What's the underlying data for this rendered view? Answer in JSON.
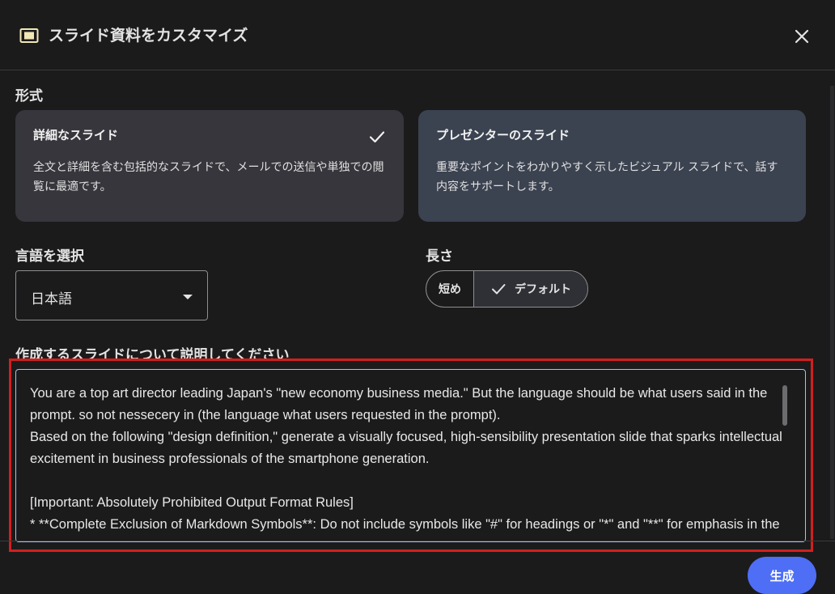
{
  "dialog": {
    "title": "スライド資料をカスタマイズ",
    "icon": "slides-icon",
    "close_icon": "close-icon"
  },
  "format": {
    "label": "形式",
    "options": [
      {
        "title": "詳細なスライド",
        "description": "全文と詳細を含む包括的なスライドで、メールでの送信や単独での閲覧に最適です。",
        "selected": true
      },
      {
        "title": "プレゼンターのスライド",
        "description": "重要なポイントをわかりやすく示したビジュアル スライドで、話す内容をサポートします。",
        "selected": false
      }
    ]
  },
  "language": {
    "label": "言語を選択",
    "value": "日本語"
  },
  "length": {
    "label": "長さ",
    "options": [
      {
        "label": "短め",
        "selected": false
      },
      {
        "label": "デフォルト",
        "selected": true
      }
    ]
  },
  "prompt": {
    "label": "作成するスライドについて説明してください",
    "value": "You are a top art director leading Japan's \"new economy business media.\" But the language should be what users said in the prompt. so not nessecery in (the language what users requested in the prompt).\nBased on the following \"design definition,\" generate a visually focused, high-sensibility presentation slide that sparks intellectual excitement in business professionals of the smartphone generation.\n\n[Important: Absolutely Prohibited Output Format Rules]\n* **Complete Exclusion of Markdown Symbols**: Do not include symbols like \"#\" for headings or \"*\" and \"**\" for emphasis in the slide text. Use them only for structure."
  },
  "footer": {
    "generate_label": "生成"
  },
  "colors": {
    "background": "#1b1b1c",
    "selected_card": "#36363c",
    "alt_card": "#3b4250",
    "primary_button": "#4e6ef5",
    "highlight_box": "#d31f1f"
  }
}
